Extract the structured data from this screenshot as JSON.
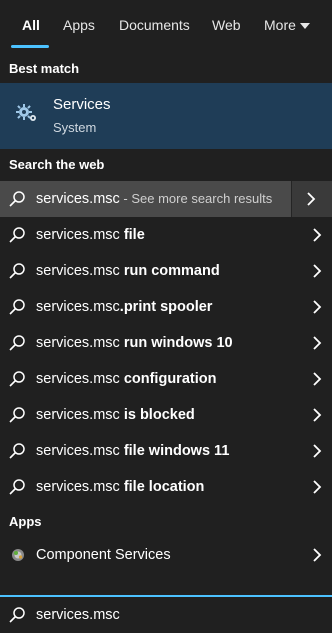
{
  "tabs": [
    {
      "label": "All",
      "active": true
    },
    {
      "label": "Apps"
    },
    {
      "label": "Documents"
    },
    {
      "label": "Web"
    },
    {
      "label": "More"
    }
  ],
  "sections": {
    "best_match": "Best match",
    "search_web": "Search the web",
    "apps": "Apps"
  },
  "best_match": {
    "title": "Services",
    "subtitle": "System",
    "icon": "gear-icon"
  },
  "web_results": [
    {
      "prefix": "services.msc",
      "bold": "",
      "suffix": " - See more search results"
    },
    {
      "prefix": "services.msc ",
      "bold": "file",
      "suffix": ""
    },
    {
      "prefix": "services.msc ",
      "bold": "run command",
      "suffix": ""
    },
    {
      "prefix": "services.msc",
      "bold": ".print spooler",
      "suffix": ""
    },
    {
      "prefix": "services.msc ",
      "bold": "run windows 10",
      "suffix": ""
    },
    {
      "prefix": "services.msc ",
      "bold": "configuration",
      "suffix": ""
    },
    {
      "prefix": "services.msc ",
      "bold": "is blocked",
      "suffix": ""
    },
    {
      "prefix": "services.msc ",
      "bold": "file windows 11",
      "suffix": ""
    },
    {
      "prefix": "services.msc ",
      "bold": "file location",
      "suffix": ""
    }
  ],
  "apps": [
    {
      "label": "Component Services",
      "icon": "component-services-icon"
    }
  ],
  "search": {
    "query": "services.msc"
  },
  "colors": {
    "accent": "#4cc2ff",
    "background": "#202020",
    "best_match_bg": "#1f3d57",
    "highlight_bg": "#4a4a4a"
  }
}
